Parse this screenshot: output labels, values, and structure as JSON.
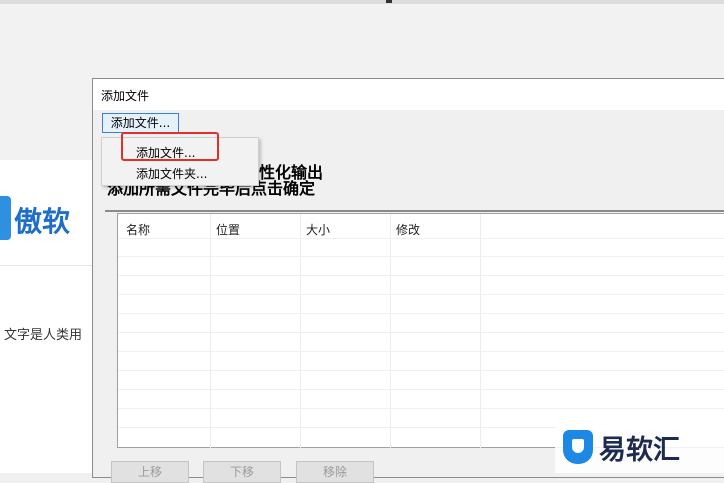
{
  "background": {
    "brand_text": "傲软",
    "body_text": "文字是人类用"
  },
  "dialog": {
    "title": "添加文件",
    "toolbar_button": "添加文件...",
    "hint_line1": "性化输出",
    "hint_line2": "添加所需文件完毕后点击确定",
    "table_headers": [
      "名称",
      "位置",
      "大小",
      "修改"
    ],
    "bottom_buttons": [
      "上移",
      "下移",
      "移除"
    ]
  },
  "menu": {
    "items": [
      "添加文件...",
      "添加文件夹..."
    ]
  },
  "watermark": {
    "text": "易软汇"
  },
  "colors": {
    "highlight": "#e0302b",
    "focus_border": "#3c7fd6",
    "brand_blue": "#1f6fc9"
  }
}
